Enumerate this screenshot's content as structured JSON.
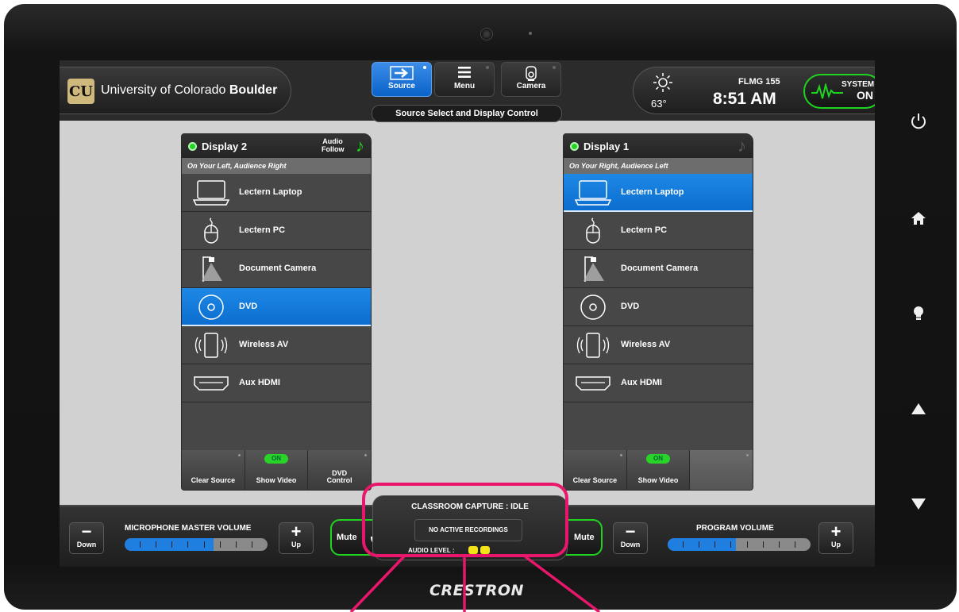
{
  "header": {
    "logo_text": "CU",
    "university_prefix": "University of Colorado",
    "university_bold": "Boulder",
    "nav": [
      {
        "label": "Source",
        "icon": "arrow-right-icon",
        "active": true
      },
      {
        "label": "Menu",
        "icon": "hamburger-menu-icon",
        "active": false
      },
      {
        "label": "Camera",
        "icon": "camera-icon",
        "active": false
      }
    ],
    "page_title": "Source Select and Display Control",
    "temperature": "63°",
    "room": "FLMG 155",
    "time": "8:51 AM",
    "system": {
      "label": "SYSTEM",
      "state": "ON"
    }
  },
  "displays": [
    {
      "title": "Display 2",
      "audio_follow": "Audio Follow",
      "audio_follow_active": true,
      "location": "On Your Left,  Audience Right",
      "sources": [
        "Lectern Laptop",
        "Lectern PC",
        "Document Camera",
        "DVD",
        "Wireless AV",
        "Aux HDMI"
      ],
      "selected_source": "DVD",
      "footer": {
        "clear": "Clear Source",
        "show_video": "Show Video",
        "on_pill": "ON",
        "dvd_line1": "DVD",
        "dvd_line2": "Control"
      }
    },
    {
      "title": "Display 1",
      "audio_follow": "",
      "audio_follow_active": false,
      "location": "On Your Right,  Audience Left",
      "sources": [
        "Lectern Laptop",
        "Lectern PC",
        "Document Camera",
        "DVD",
        "Wireless AV",
        "Aux HDMI"
      ],
      "selected_source": "Lectern Laptop",
      "footer": {
        "clear": "Clear Source",
        "show_video": "Show Video",
        "on_pill": "ON"
      }
    }
  ],
  "audio": {
    "mic": {
      "title": "MICROPHONE MASTER VOLUME",
      "down": "Down",
      "up": "Up",
      "level_percent": 62,
      "mute": "Mute"
    },
    "program": {
      "title": "PROGRAM VOLUME",
      "down": "Down",
      "up": "Up",
      "level_percent": 48,
      "mute": "Mute"
    }
  },
  "capture": {
    "title": "CLASSROOM CAPTURE : IDLE",
    "status": "NO ACTIVE RECORDINGS",
    "audio_level_label": "AUDIO LEVEL :"
  },
  "device": {
    "brand": "CRESTRON"
  },
  "colors": {
    "accent_blue": "#0b6ed0",
    "status_green": "#1fd41f",
    "highlight_pink": "#e8176b"
  }
}
